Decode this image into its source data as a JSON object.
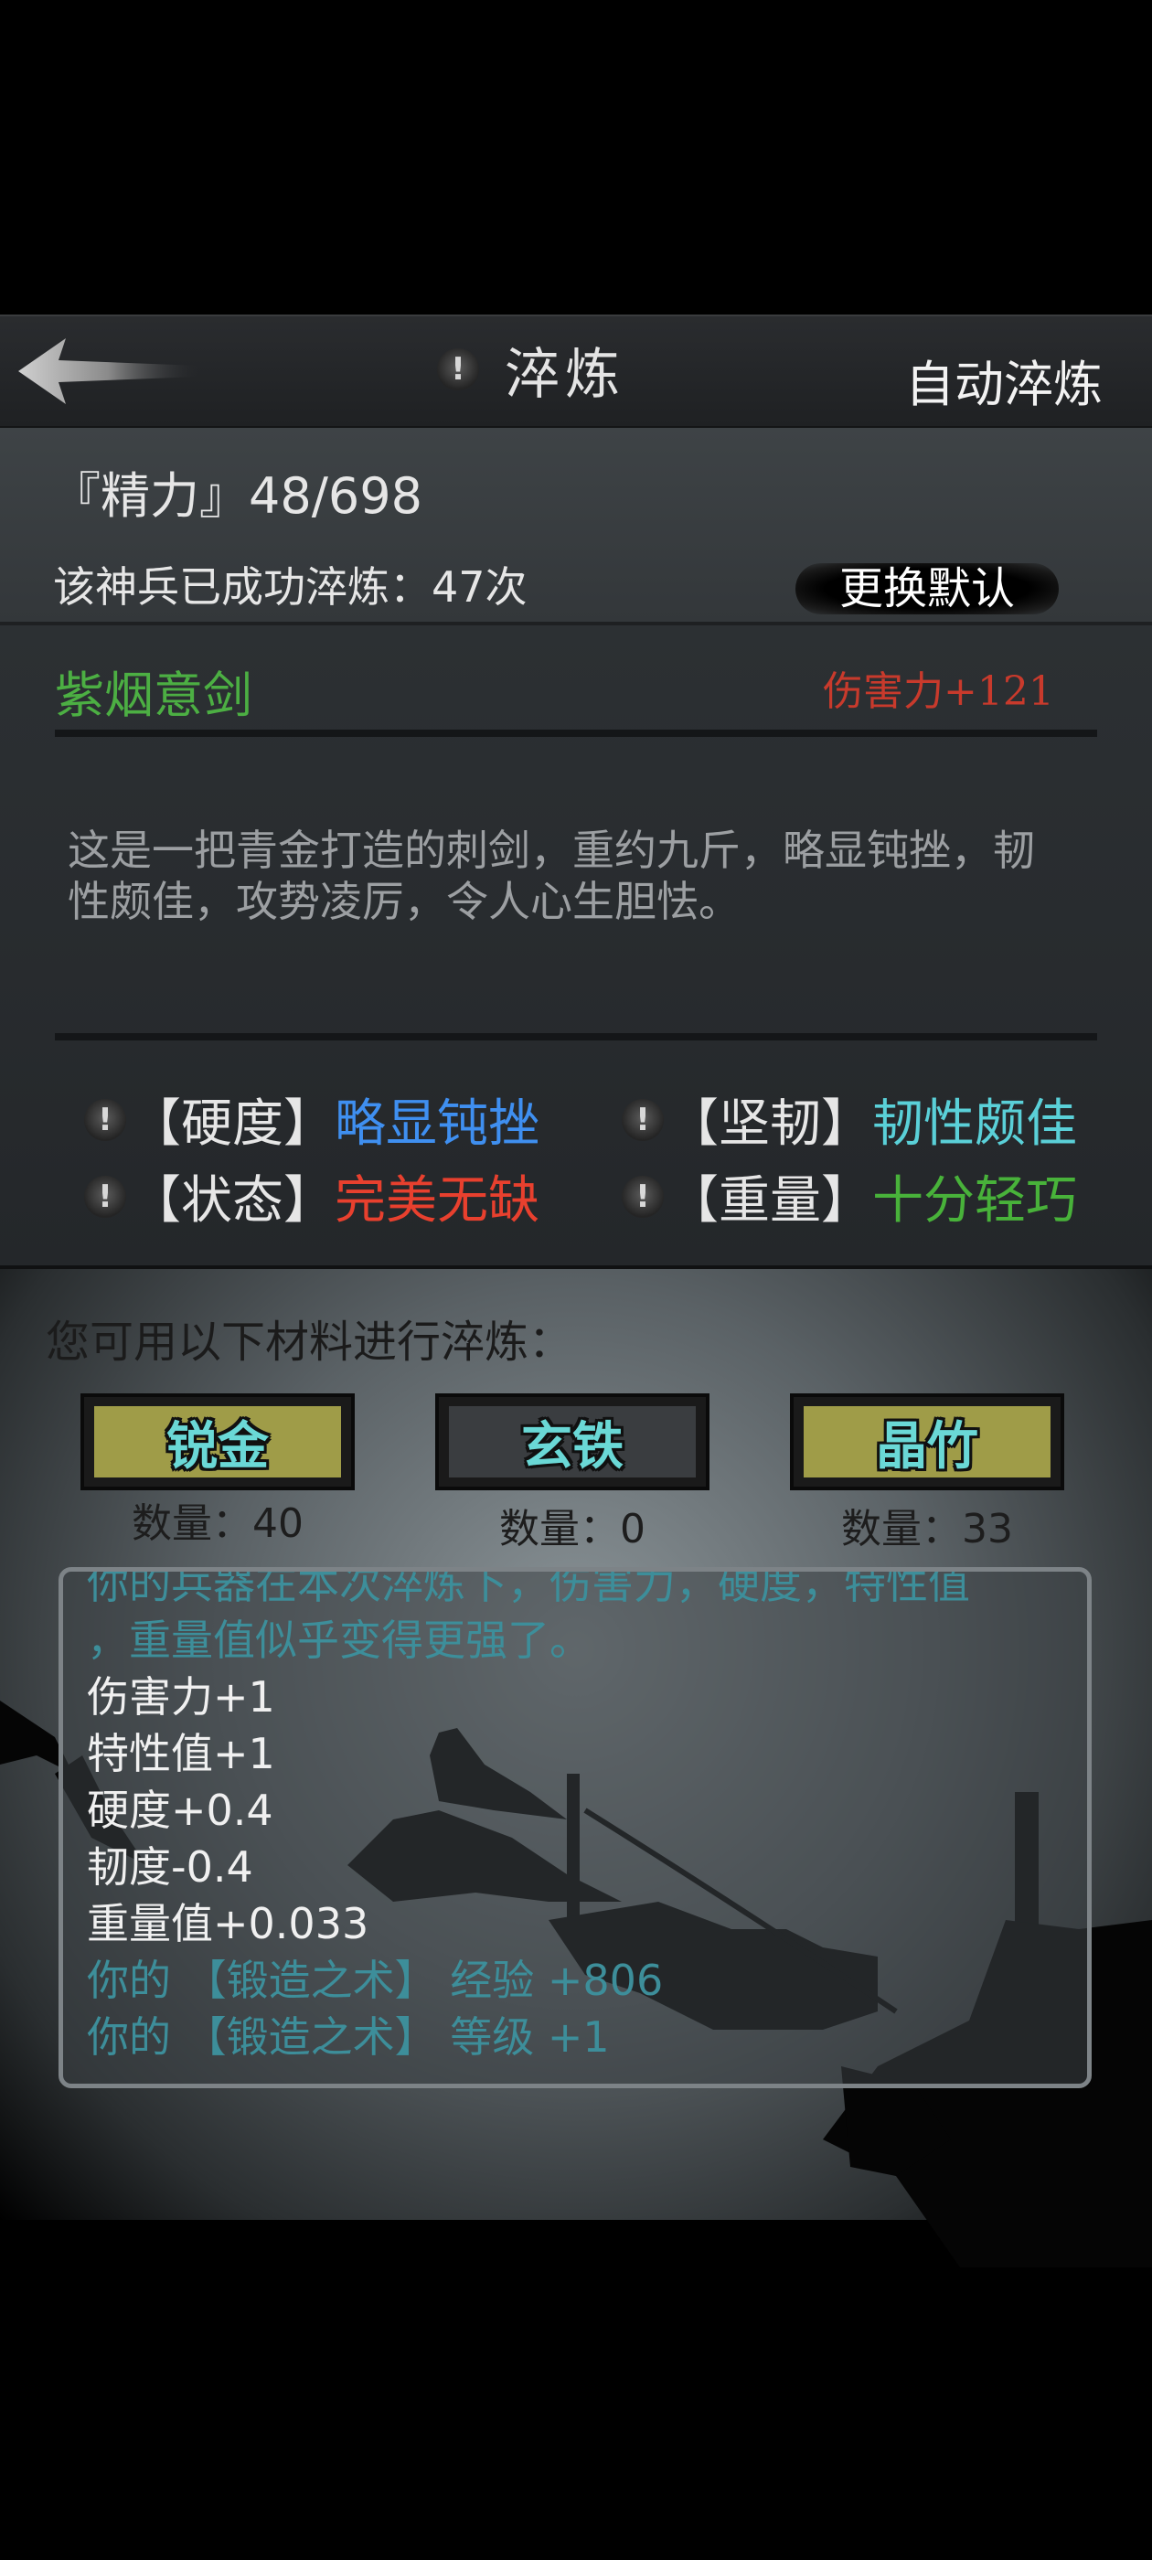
{
  "header": {
    "back_icon": "back-arrow-icon",
    "info_icon": "!",
    "title": "淬炼",
    "auto_refine_label": "自动淬炼"
  },
  "status": {
    "stamina": "『精力』48/698",
    "refine_count": "该神兵已成功淬炼：47次",
    "change_default_label": "更换默认"
  },
  "weapon": {
    "name": "紫烟意剑",
    "damage": "伤害力+121",
    "description": "这是一把青金打造的刺剑，重约九斤，略显钝挫，韧性颇佳，攻势凌厉，令人心生胆怯。",
    "attributes": [
      {
        "icon": "!",
        "key": "【硬度】",
        "value": "略显钝挫",
        "color": "#3f8ff0"
      },
      {
        "icon": "!",
        "key": "【坚韧】",
        "value": "韧性颇佳",
        "color": "#5ad0d8"
      },
      {
        "icon": "!",
        "key": "【状态】",
        "value": "完美无缺",
        "color": "#e8402e"
      },
      {
        "icon": "!",
        "key": "【重量】",
        "value": "十分轻巧",
        "color": "#48b23a"
      }
    ]
  },
  "materials": {
    "label": "您可用以下材料进行淬炼：",
    "items": [
      {
        "name": "锐金",
        "qty": "数量：40",
        "fill": "#9f9c48",
        "available": true
      },
      {
        "name": "玄铁",
        "qty": "数量：0",
        "fill": "#3a3d40",
        "available": false
      },
      {
        "name": "晶竹",
        "qty": "数量：33",
        "fill": "#9f9c48",
        "available": true
      }
    ]
  },
  "log": {
    "lines": [
      {
        "text": "你的兵器在本次淬炼下，伤害力，硬度，特性值",
        "style": "cyan"
      },
      {
        "text": "，重量值似乎变得更强了。",
        "style": "cyan"
      },
      {
        "text": "伤害力+1",
        "style": "white"
      },
      {
        "text": "特性值+1",
        "style": "white"
      },
      {
        "text": "硬度+0.4",
        "style": "white"
      },
      {
        "text": "韧度-0.4",
        "style": "white"
      },
      {
        "text": "重量值+0.033",
        "style": "white"
      },
      {
        "text": "你的 【锻造之术】 经验 +806",
        "style": "cyan"
      },
      {
        "text": "你的 【锻造之术】 等级 +1",
        "style": "cyan"
      }
    ]
  }
}
